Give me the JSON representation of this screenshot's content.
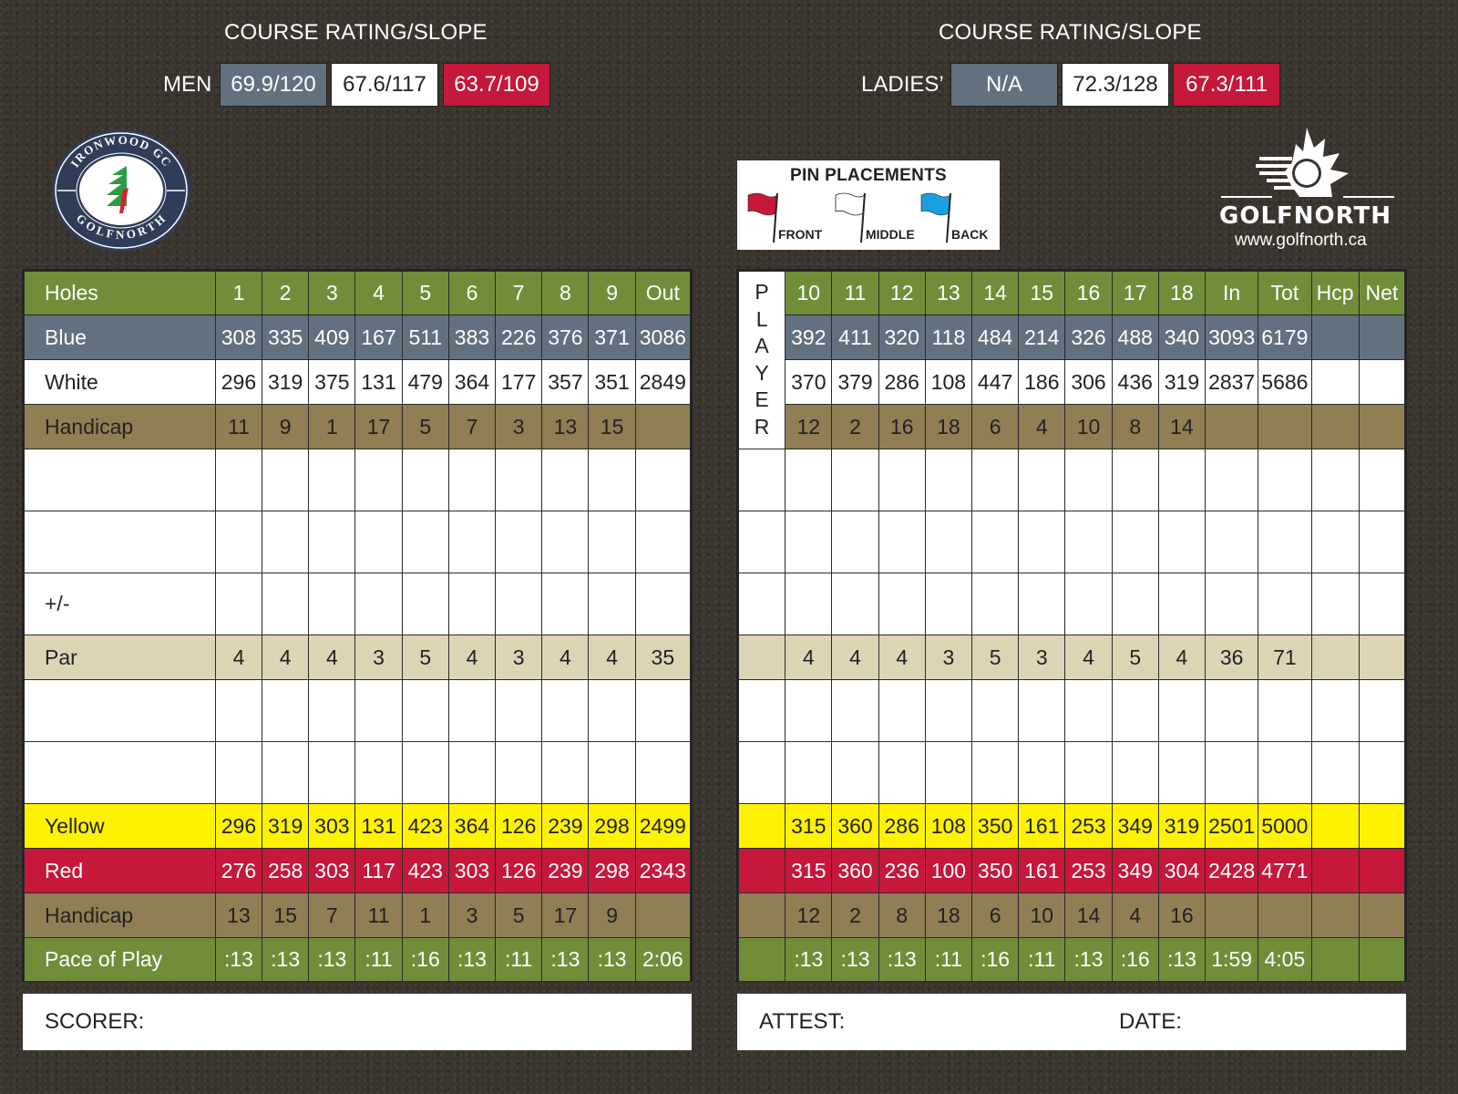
{
  "ratings": {
    "men": {
      "title": "COURSE RATING/SLOPE",
      "label": "MEN",
      "blue": "69.9/120",
      "white": "67.6/117",
      "red": "63.7/109"
    },
    "ladies": {
      "title": "COURSE RATING/SLOPE",
      "label": "LADIES’",
      "blue": "N/A",
      "white": "72.3/128",
      "red": "67.3/111"
    }
  },
  "club_logo": {
    "top_text": "IRONWOOD GC",
    "bottom_text": "GOLFNORTH",
    "icon": "pine-tree-icon"
  },
  "pin_placements": {
    "title": "PIN PLACEMENTS",
    "flags": [
      {
        "label": "FRONT",
        "color": "#c5183a",
        "icon": "flag-icon"
      },
      {
        "label": "MIDDLE",
        "color": "#ffffff",
        "icon": "flag-icon"
      },
      {
        "label": "BACK",
        "color": "#1a9fe0",
        "icon": "flag-icon"
      }
    ]
  },
  "brand": {
    "name": "GOLFNORTH",
    "url": "www.golfnorth.ca",
    "icon": "maple-leaf-golf-ball-icon"
  },
  "colors": {
    "green": "#708e3a",
    "blue_tee": "#627180",
    "white_tee": "#ffffff",
    "handicap": "#907e55",
    "par": "#ddd4b6",
    "yellow_tee": "#fff200",
    "red_tee": "#c5183a"
  },
  "front": {
    "header": [
      "Holes",
      "1",
      "2",
      "3",
      "4",
      "5",
      "6",
      "7",
      "8",
      "9",
      "Out"
    ],
    "blue": [
      "Blue",
      "308",
      "335",
      "409",
      "167",
      "511",
      "383",
      "226",
      "376",
      "371",
      "3086"
    ],
    "white": [
      "White",
      "296",
      "319",
      "375",
      "131",
      "479",
      "364",
      "177",
      "357",
      "351",
      "2849"
    ],
    "handicap_men": [
      "Handicap",
      "11",
      "9",
      "1",
      "17",
      "5",
      "7",
      "3",
      "13",
      "15",
      ""
    ],
    "plusminus": [
      "+/-",
      "",
      "",
      "",
      "",
      "",
      "",
      "",
      "",
      "",
      ""
    ],
    "par": [
      "Par",
      "4",
      "4",
      "4",
      "3",
      "5",
      "4",
      "3",
      "4",
      "4",
      "35"
    ],
    "yellow": [
      "Yellow",
      "296",
      "319",
      "303",
      "131",
      "423",
      "364",
      "126",
      "239",
      "298",
      "2499"
    ],
    "red": [
      "Red",
      "276",
      "258",
      "303",
      "117",
      "423",
      "303",
      "126",
      "239",
      "298",
      "2343"
    ],
    "handicap_ladies": [
      "Handicap",
      "13",
      "15",
      "7",
      "11",
      "1",
      "3",
      "5",
      "17",
      "9",
      ""
    ],
    "pace": [
      "Pace of Play",
      ":13",
      ":13",
      ":13",
      ":11",
      ":16",
      ":13",
      ":11",
      ":13",
      ":13",
      "2:06"
    ]
  },
  "back": {
    "player_label": [
      "P",
      "L",
      "A",
      "Y",
      "E",
      "R"
    ],
    "header": [
      "10",
      "11",
      "12",
      "13",
      "14",
      "15",
      "16",
      "17",
      "18",
      "In",
      "Tot",
      "Hcp",
      "Net"
    ],
    "blue": [
      "392",
      "411",
      "320",
      "118",
      "484",
      "214",
      "326",
      "488",
      "340",
      "3093",
      "6179",
      "",
      ""
    ],
    "white": [
      "370",
      "379",
      "286",
      "108",
      "447",
      "186",
      "306",
      "436",
      "319",
      "2837",
      "5686",
      "",
      ""
    ],
    "handicap_men": [
      "12",
      "2",
      "16",
      "18",
      "6",
      "4",
      "10",
      "8",
      "14",
      "",
      "",
      "",
      ""
    ],
    "par": [
      "4",
      "4",
      "4",
      "3",
      "5",
      "3",
      "4",
      "5",
      "4",
      "36",
      "71",
      "",
      ""
    ],
    "yellow": [
      "315",
      "360",
      "286",
      "108",
      "350",
      "161",
      "253",
      "349",
      "319",
      "2501",
      "5000",
      "",
      ""
    ],
    "red": [
      "315",
      "360",
      "236",
      "100",
      "350",
      "161",
      "253",
      "349",
      "304",
      "2428",
      "4771",
      "",
      ""
    ],
    "handicap_ladies": [
      "12",
      "2",
      "8",
      "18",
      "6",
      "10",
      "14",
      "4",
      "16",
      "",
      "",
      "",
      ""
    ],
    "pace": [
      ":13",
      ":13",
      ":13",
      ":11",
      ":16",
      ":11",
      ":13",
      ":16",
      ":13",
      "1:59",
      "4:05",
      "",
      ""
    ]
  },
  "signatures": {
    "scorer": "SCORER:",
    "attest": "ATTEST:",
    "date": "DATE:"
  }
}
